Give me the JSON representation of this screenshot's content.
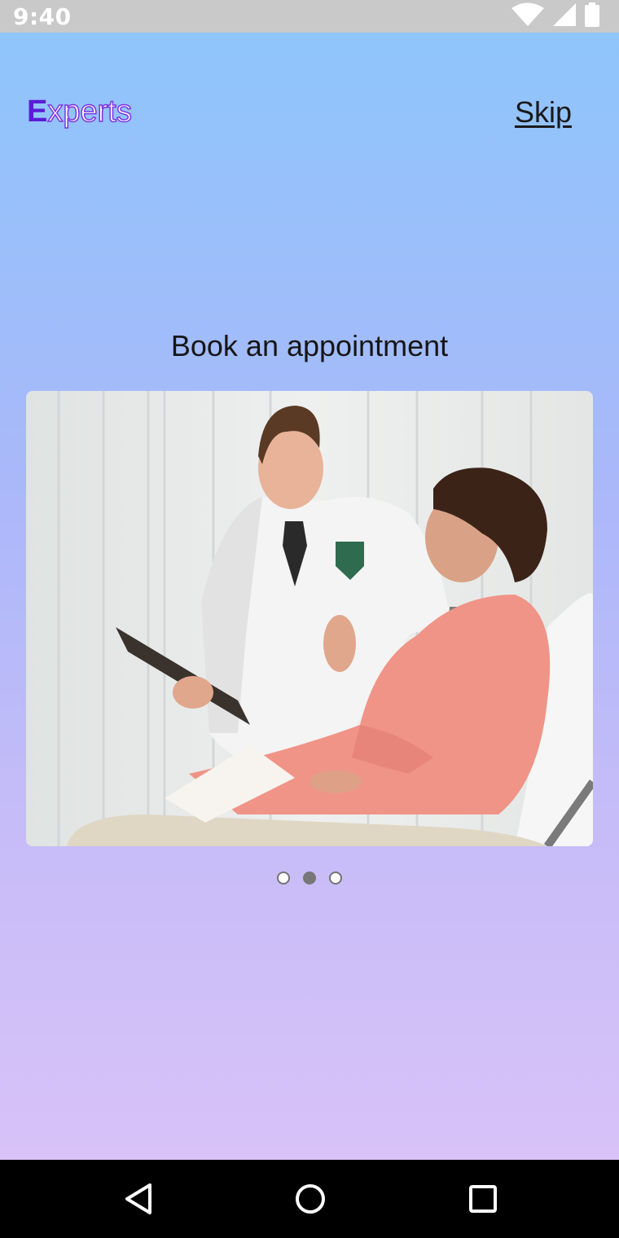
{
  "status_bar": {
    "time": "9:40",
    "icons": [
      "wifi-icon",
      "cell-signal-icon",
      "battery-icon"
    ]
  },
  "header": {
    "brand_initial": "E",
    "brand_rest": "xperts",
    "skip_label": "Skip"
  },
  "onboarding": {
    "title": "Book an appointment",
    "image_description": "doctor-with-patient-photo",
    "pager": {
      "count": 3,
      "active_index": 1
    }
  },
  "nav_bar": {
    "icons": [
      "back-icon",
      "home-icon",
      "recents-icon"
    ]
  },
  "colors": {
    "gradient_top": "#8ec5fb",
    "gradient_bottom": "#d8c2f8",
    "brand_purple": "#5b1cd6",
    "status_bar": "#c9c9c9",
    "nav_bar": "#000000"
  }
}
